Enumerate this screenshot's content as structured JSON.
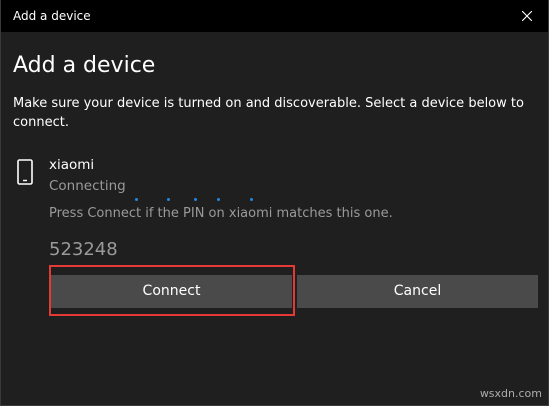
{
  "window": {
    "title": "Add a device"
  },
  "dialog": {
    "heading": "Add a device",
    "instructions": "Make sure your device is turned on and discoverable. Select a device below to connect."
  },
  "device": {
    "name": "xiaomi",
    "status": "Connecting",
    "icon": "phone-icon",
    "pin_prompt": "Press Connect if the PIN on xiaomi matches this one.",
    "pin": "523248"
  },
  "buttons": {
    "connect_label": "Connect",
    "cancel_label": "Cancel"
  },
  "watermark": "wsxdn.com",
  "colors": {
    "background": "#1f1f1f",
    "titlebar": "#000000",
    "button": "#4a4a4a",
    "highlight": "#e53935",
    "progress": "#1e88e5",
    "secondary_text": "#9a9a9a"
  }
}
